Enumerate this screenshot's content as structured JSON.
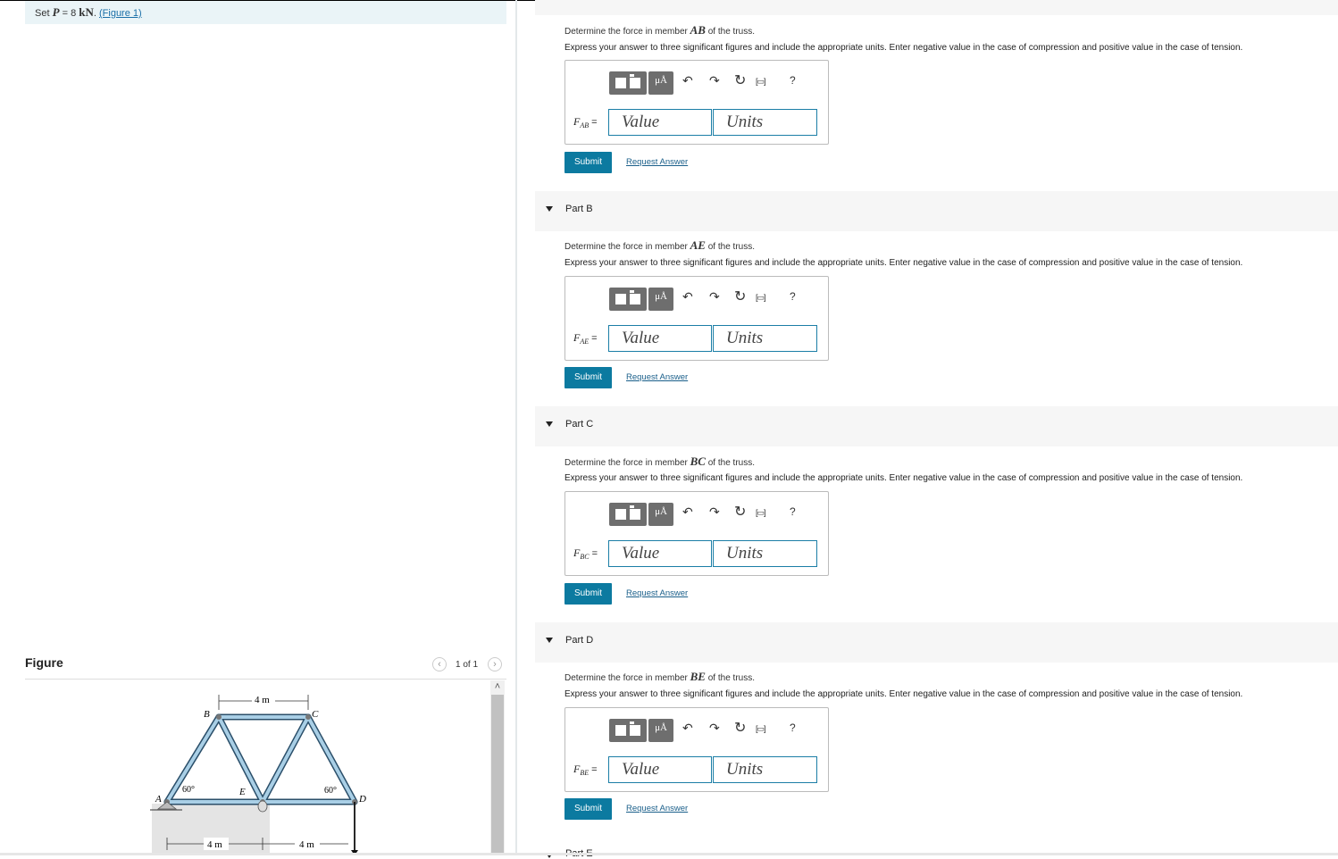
{
  "given": {
    "prefix": "Set",
    "symbol": "P",
    "eq": " = 8 ",
    "unit": "kN",
    "period": ". ",
    "figure_link": "(Figure 1)"
  },
  "figure_panel": {
    "title": "Figure",
    "pager": {
      "count": "1 of 1",
      "prev_icon": "chevron-left-icon",
      "next_icon": "chevron-right-icon"
    },
    "truss_labels": {
      "A": "A",
      "B": "B",
      "C": "C",
      "D": "D",
      "E": "E",
      "top_dim": "4 m",
      "bot_dim_left": "4 m",
      "bot_dim_right": "4 m",
      "angle_left": "60°",
      "angle_right": "60°"
    }
  },
  "toolbar": {
    "mu_label": "μÅ",
    "help_label": "?"
  },
  "inputs": {
    "value_placeholder": "Value",
    "units_placeholder": "Units"
  },
  "instructions": "Express your answer to three significant figures and include the appropriate units. Enter negative value in the case of compression and positive value in the case of tension.",
  "parts": [
    {
      "header": "",
      "q_pre": "Determine the force in member ",
      "member": "AB",
      "q_post": " of the truss.",
      "field": "F",
      "sub": "AB",
      "eq": " =",
      "submit": "Submit",
      "request": "Request Answer"
    },
    {
      "header": "Part B",
      "q_pre": "Determine the force in member ",
      "member": "AE",
      "q_post": " of the truss.",
      "field": "F",
      "sub": "AE",
      "eq": " =",
      "submit": "Submit",
      "request": "Request Answer"
    },
    {
      "header": "Part C",
      "q_pre": "Determine the force in member ",
      "member": "BC",
      "q_post": " of the truss.",
      "field": "F",
      "sub": "BC",
      "eq": " =",
      "submit": "Submit",
      "request": "Request Answer"
    },
    {
      "header": "Part D",
      "q_pre": "Determine the force in member ",
      "member": "BE",
      "q_post": " of the truss.",
      "field": "F",
      "sub": "BE",
      "eq": " =",
      "submit": "Submit",
      "request": "Request Answer"
    }
  ],
  "next_part_header": "Part E"
}
